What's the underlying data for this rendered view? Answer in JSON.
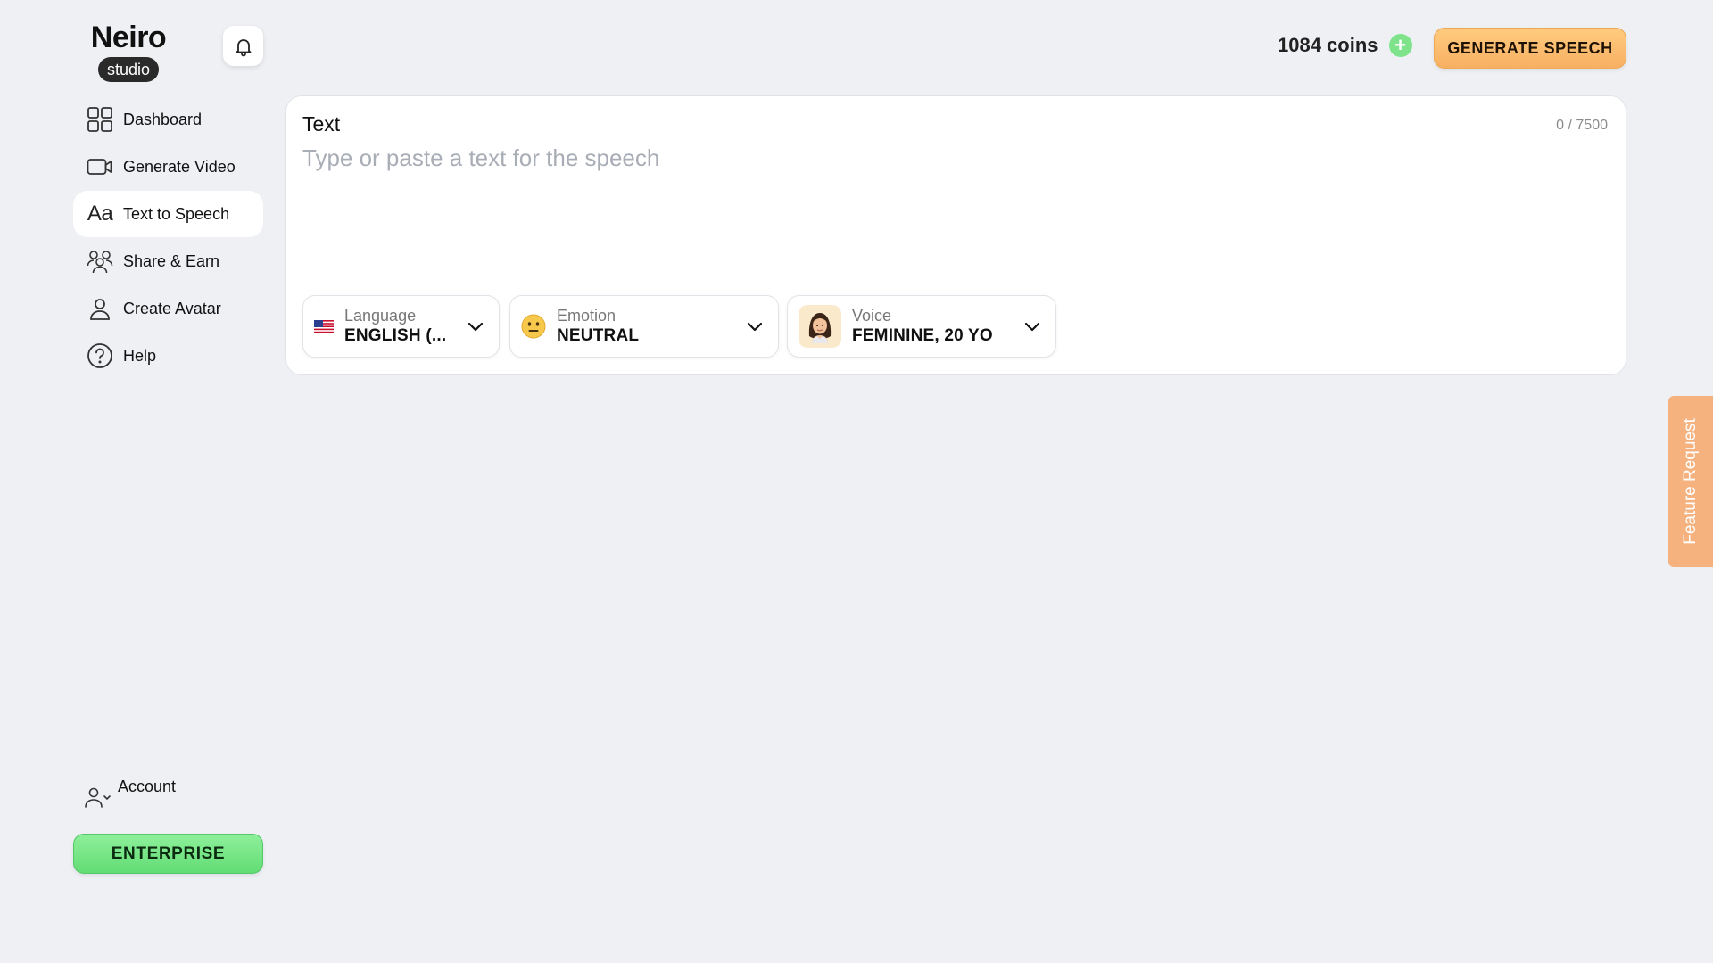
{
  "logo": {
    "name": "Neiro",
    "badge": "studio"
  },
  "sidebar": {
    "items": [
      {
        "label": "Dashboard",
        "icon": "dashboard-grid-icon"
      },
      {
        "label": "Generate Video",
        "icon": "video-camera-icon"
      },
      {
        "label": "Text to Speech",
        "icon": "text-aa-icon",
        "glyph": "Aa",
        "active": true
      },
      {
        "label": "Share & Earn",
        "icon": "users-group-icon"
      },
      {
        "label": "Create Avatar",
        "icon": "user-icon"
      },
      {
        "label": "Help",
        "icon": "help-circle-icon"
      }
    ],
    "account_label": "Account",
    "enterprise_label": "ENTERPRISE"
  },
  "topbar": {
    "coins_label": "1084 coins",
    "coin_plus": "+",
    "generate_label": "GENERATE SPEECH"
  },
  "editor": {
    "title": "Text",
    "char_count": "0 / 7500",
    "placeholder": "Type or paste a text for the speech",
    "value": ""
  },
  "dropdowns": {
    "language": {
      "label": "Language",
      "value": "ENGLISH (...",
      "icon": "us-flag-icon"
    },
    "emotion": {
      "label": "Emotion",
      "value": "NEUTRAL",
      "icon": "neutral-face-icon"
    },
    "voice": {
      "label": "Voice",
      "value": "FEMININE, 20 YO",
      "icon": "female-avatar-icon"
    }
  },
  "feature_request_label": "Feature Request",
  "colors": {
    "background": "#eff0f4",
    "generate_button": "#f7b063",
    "enterprise_button": "#62dc75",
    "coin_plus": "#7fe38b",
    "feature_tab": "#f5b27f"
  }
}
